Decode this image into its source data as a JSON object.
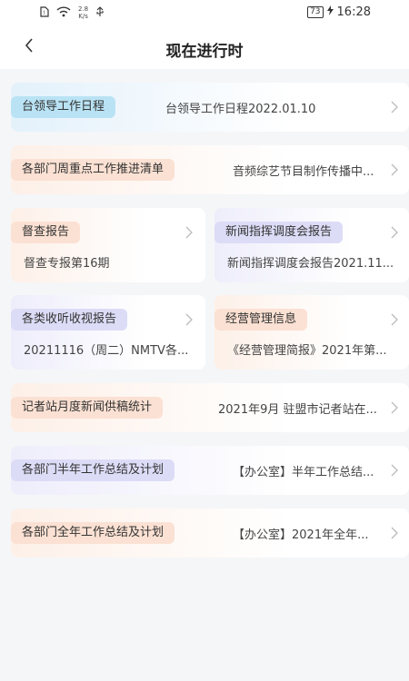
{
  "status_bar": {
    "net_speed_value": "2.8",
    "net_speed_unit": "K/s",
    "battery_level": "73",
    "time": "16:28"
  },
  "header": {
    "title": "现在进行时"
  },
  "cards": [
    {
      "tag": "台领导工作日程",
      "desc": "台领导工作日程2022.01.10"
    },
    {
      "tag": "各部门周重点工作推进清单",
      "desc": "音频综艺节目制作传播中..."
    },
    {
      "tag": "督查报告",
      "desc": "督查专报第16期"
    },
    {
      "tag": "新闻指挥调度会报告",
      "desc": "新闻指挥调度会报告2021.11..."
    },
    {
      "tag": "各类收听收视报告",
      "desc": "20211116（周二）NMTV各..."
    },
    {
      "tag": "经营管理信息",
      "desc": "《经营管理简报》2021年第..."
    },
    {
      "tag": "记者站月度新闻供稿统计",
      "desc": "2021年9月 驻盟市记者站在..."
    },
    {
      "tag": "各部门半年工作总结及计划",
      "desc": "【办公室】半年工作总结..."
    },
    {
      "tag": "各部门全年工作总结及计划",
      "desc": "【办公室】2021年全年..."
    }
  ]
}
